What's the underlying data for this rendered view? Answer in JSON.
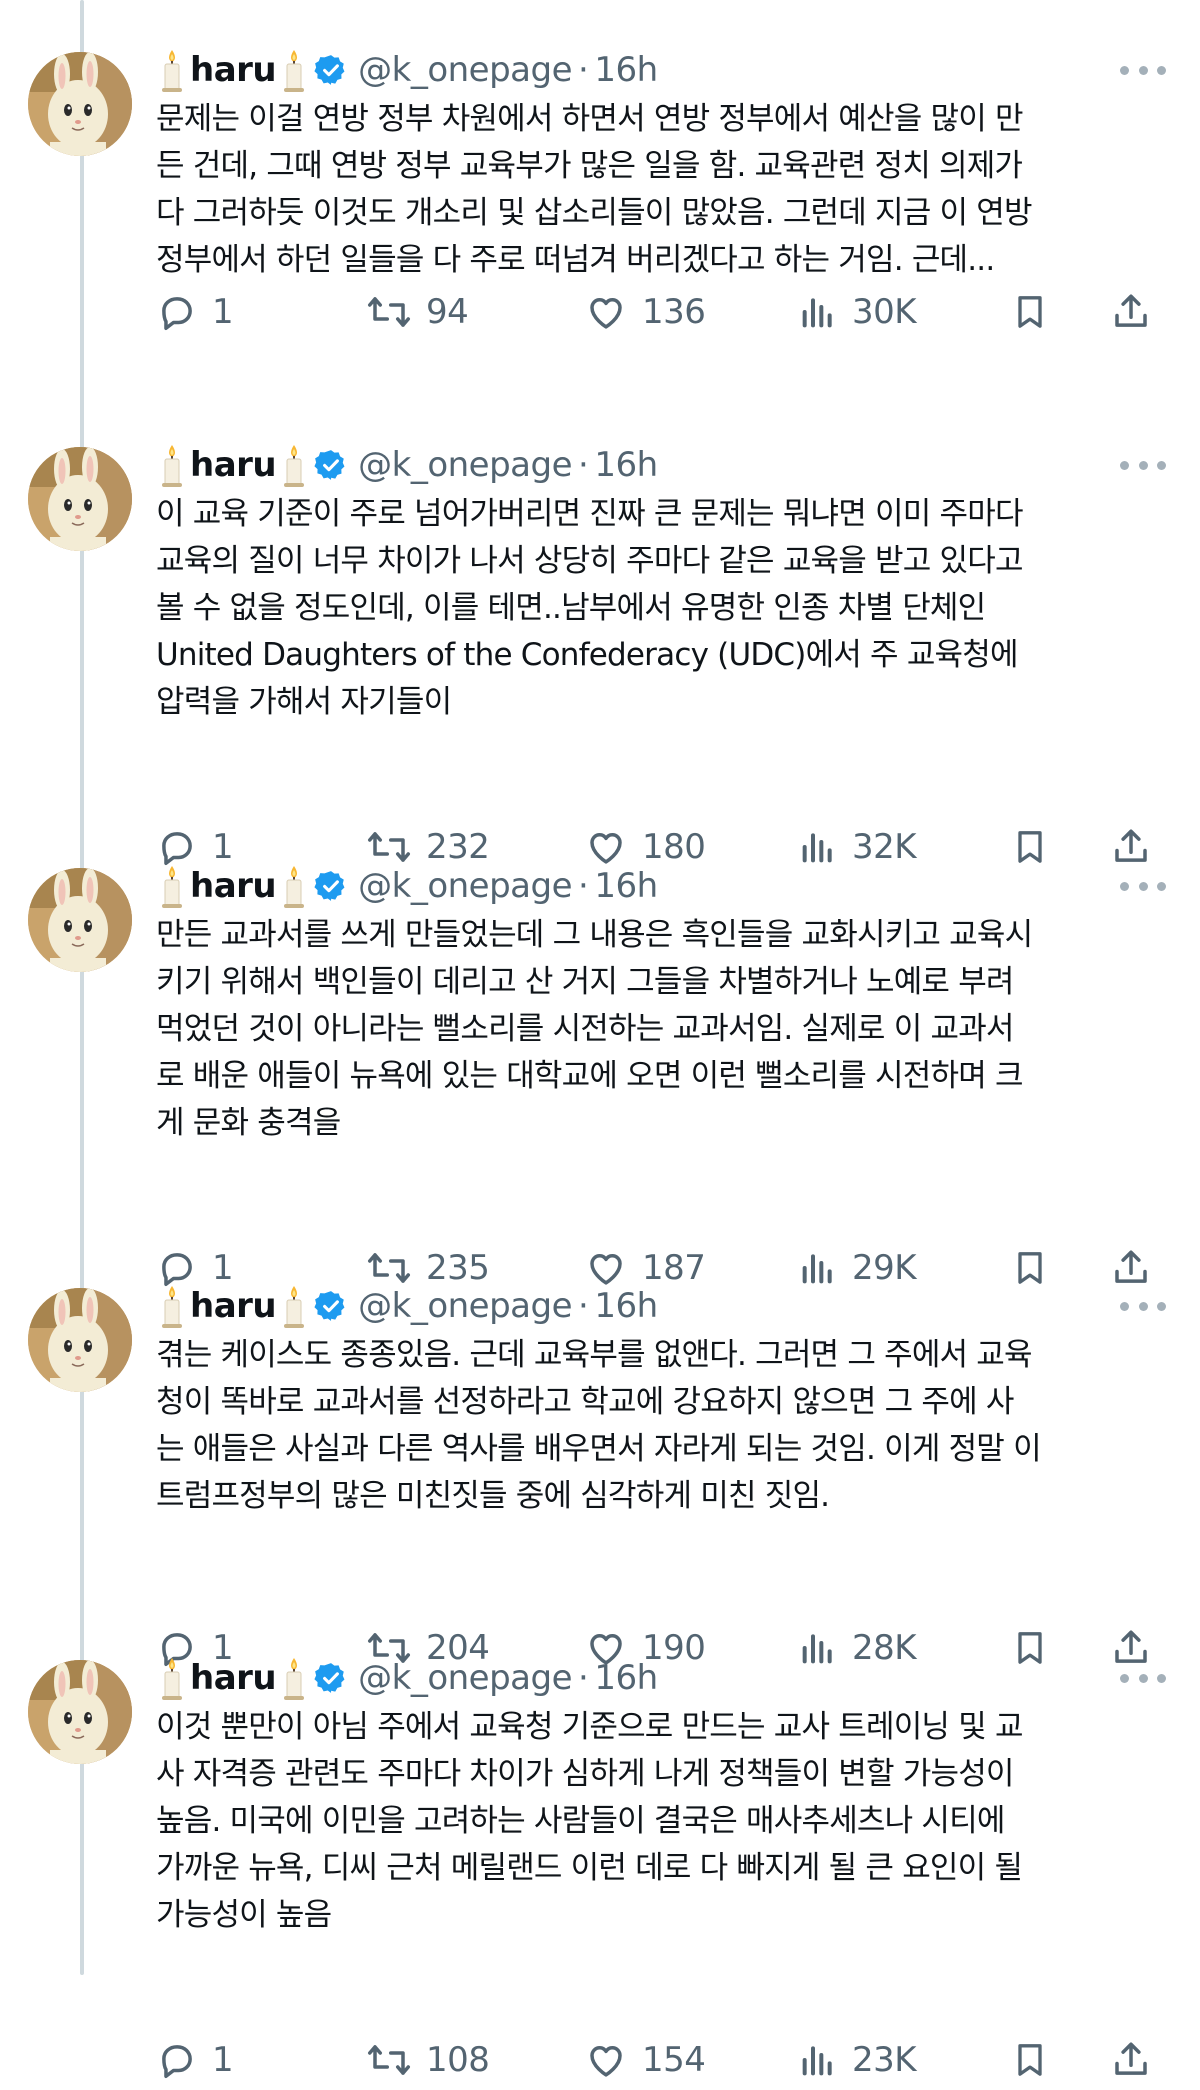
{
  "colors": {
    "text": "#0f1419",
    "muted": "#536471",
    "verified": "#1d9bf0",
    "thread_line": "#cfd9de"
  },
  "icons": [
    "candle-icon",
    "verified-badge-icon",
    "more-icon",
    "reply-icon",
    "retweet-icon",
    "like-icon",
    "views-icon",
    "bookmark-icon",
    "share-icon"
  ],
  "tweets": [
    {
      "name": "haru",
      "handle": "@k_onepage",
      "separator": "·",
      "time": "16h",
      "lines": [
        "문제는 이걸 연방 정부 차원에서 하면서 연방 정부에서 예산을 많이 만",
        "든 건데, 그때 연방 정부 교육부가 많은 일을 함. 교육관련 정치 의제가",
        "다 그러하듯 이것도 개소리 및 삽소리들이 많았음. 그런데 지금 이 연방",
        "정부에서 하던 일들을 다 주로 떠넘겨 버리겠다고 하는 거임. 근데..."
      ],
      "replies": "1",
      "retweets": "94",
      "likes": "136",
      "views": "30K"
    },
    {
      "name": "haru",
      "handle": "@k_onepage",
      "separator": "·",
      "time": "16h",
      "lines": [
        "이 교육 기준이 주로 넘어가버리면 진짜 큰 문제는 뭐냐면 이미 주마다",
        "교육의 질이 너무 차이가 나서 상당히 주마다 같은 교육을 받고 있다고",
        "볼 수 없을 정도인데, 이를 테면..남부에서 유명한 인종 차별 단체인",
        "United Daughters of the Confederacy (UDC)에서 주 교육청에",
        "압력을 가해서 자기들이"
      ],
      "replies": "1",
      "retweets": "232",
      "likes": "180",
      "views": "32K"
    },
    {
      "name": "haru",
      "handle": "@k_onepage",
      "separator": "·",
      "time": "16h",
      "lines": [
        "만든 교과서를 쓰게 만들었는데 그 내용은 흑인들을 교화시키고 교육시",
        "키기 위해서 백인들이 데리고 산 거지 그들을 차별하거나 노예로 부려",
        "먹었던 것이 아니라는 뻘소리를 시전하는 교과서임. 실제로 이 교과서",
        "로 배운 애들이 뉴욕에 있는 대학교에 오면 이런 뻘소리를 시전하며 크",
        "게 문화 충격을"
      ],
      "replies": "1",
      "retweets": "235",
      "likes": "187",
      "views": "29K"
    },
    {
      "name": "haru",
      "handle": "@k_onepage",
      "separator": "·",
      "time": "16h",
      "lines": [
        "겪는 케이스도 종종있음. 근데 교육부를 없앤다. 그러면 그 주에서 교육",
        "청이 똑바로 교과서를 선정하라고 학교에 강요하지 않으면 그 주에 사",
        "는 애들은 사실과 다른 역사를 배우면서 자라게 되는 것임. 이게 정말 이",
        "트럼프정부의 많은 미친짓들 중에 심각하게 미친 짓임."
      ],
      "replies": "1",
      "retweets": "204",
      "likes": "190",
      "views": "28K"
    },
    {
      "name": "haru",
      "handle": "@k_onepage",
      "separator": "·",
      "time": "16h",
      "lines": [
        "이것 뿐만이 아님 주에서 교육청 기준으로 만드는 교사 트레이닝 및 교",
        "사 자격증 관련도 주마다 차이가 심하게 나게 정책들이 변할 가능성이",
        "높음. 미국에 이민을 고려하는 사람들이 결국은 매사추세츠나 시티에",
        "가까운 뉴욕, 디씨  근처 메릴랜드 이런 데로 다 빠지게 될 큰 요인이 될",
        "가능성이 높음"
      ],
      "replies": "1",
      "retweets": "108",
      "likes": "154",
      "views": "23K"
    }
  ]
}
